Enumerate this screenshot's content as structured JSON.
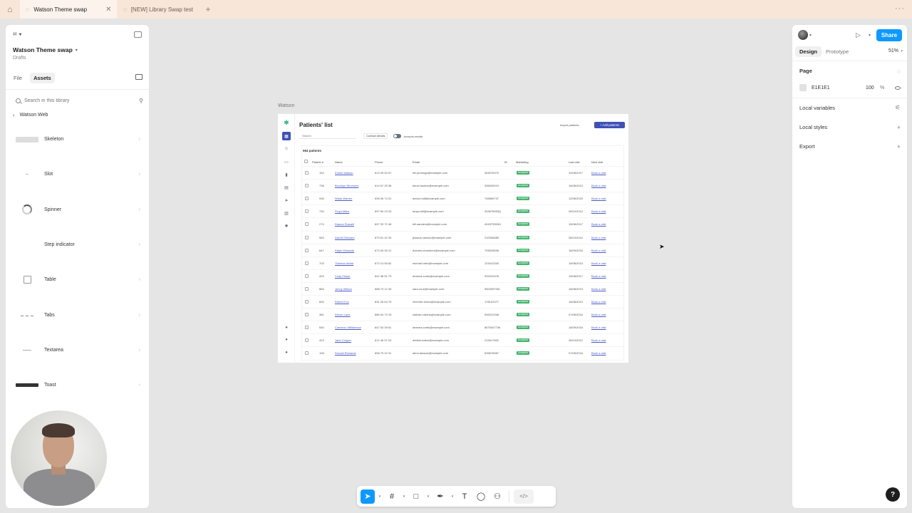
{
  "browser": {
    "tabs": [
      {
        "label": "Watson Theme swap",
        "active": true
      },
      {
        "label": "[NEW] Library Swap test",
        "active": false
      }
    ]
  },
  "left_panel": {
    "file_title": "Watson Theme swap",
    "location": "Drafts",
    "tabs": [
      "File",
      "Assets"
    ],
    "active_tab": "Assets",
    "search_placeholder": "Search in this library",
    "library_name": "Watson Web",
    "components": [
      {
        "name": "Skeleton",
        "thumb": "skeleton"
      },
      {
        "name": "Slot",
        "thumb": "slot"
      },
      {
        "name": "Spinner",
        "thumb": "spinner"
      },
      {
        "name": "Step indicator",
        "thumb": "none"
      },
      {
        "name": "Table",
        "thumb": "table"
      },
      {
        "name": "Tabs",
        "thumb": "tabs"
      },
      {
        "name": "Textarea",
        "thumb": "textarea"
      },
      {
        "name": "Toast",
        "thumb": "toast"
      }
    ]
  },
  "canvas": {
    "frame_label": "Watson",
    "frame": {
      "title": "Patients' list",
      "import_label": "Import patients",
      "add_label": "+ Add patients",
      "search_placeholder": "Search",
      "filter_label": "Contact details",
      "toggle_label": "Accepts emails",
      "count_label": "564 patients",
      "columns": [
        "Patient #",
        "Name",
        "Phone",
        "Email",
        "ID",
        "Marketing",
        "Last visit",
        "Next visit"
      ],
      "rows": [
        {
          "num": "154",
          "name": "Kristin Watson",
          "phone": "613 49 52 87",
          "email": "tim.jennings@example.com",
          "id": "353076370",
          "marketing": "Accepted",
          "last": "10/08/2017",
          "next": "Book a visit"
        },
        {
          "num": "738",
          "name": "Brooklyn Simmons",
          "phone": "614 67 25 38",
          "email": "kenzi.lawson@example.com",
          "id": "335000019",
          "marketing": "Accepted",
          "last": "16/08/2013",
          "next": "Book a visit"
        },
        {
          "num": "936",
          "name": "Wade Warren",
          "phone": "635 96 74 31",
          "email": "debra.holt@example.com",
          "id": "748589747",
          "marketing": "Accepted",
          "last": "12/06/2020",
          "next": "Book a visit"
        },
        {
          "num": "730",
          "name": "Floyd Miles",
          "phone": "697 84 23 33",
          "email": "tanya.hill@example.com",
          "id": "343676593Q",
          "marketing": "Accepted",
          "last": "28/10/2012",
          "next": "Book a visit"
        },
        {
          "num": "274",
          "name": "Dianne Russell",
          "phone": "697 33 72 48",
          "email": "bill.sanders@example.com",
          "id": "404379900H",
          "marketing": "Accepted",
          "last": "15/08/2017",
          "next": "Book a visit"
        },
        {
          "num": "563",
          "name": "Darrell Steward",
          "phone": "679 81 42 26",
          "email": "jessica.hanson@example.com",
          "id": "210006689",
          "marketing": "Accepted",
          "last": "28/10/2012",
          "next": "Book a visit"
        },
        {
          "num": "647",
          "name": "Ralph Edwards",
          "phone": "673 49 39 12",
          "email": "dolores.chambers@example.com",
          "id": "793033536",
          "marketing": "Accepted",
          "last": "18/09/2016",
          "next": "Book a visit"
        },
        {
          "num": "703",
          "name": "Theresa Webb",
          "phone": "673 14 55 82",
          "email": "michael.mitc@example.com",
          "id": "123412340",
          "marketing": "Accepted",
          "last": "16/08/2013",
          "next": "Book a visit"
        },
        {
          "num": "429",
          "name": "Cody Fisher",
          "phone": "642 38 51 79",
          "email": "deanna.curtis@example.com",
          "id": "932910378",
          "marketing": "Accepted",
          "last": "15/08/2017",
          "next": "Book a visit"
        },
        {
          "num": "883",
          "name": "Jenny Wilson",
          "phone": "688 73 12 45",
          "email": "sara.cruz@example.com",
          "id": "950335700L",
          "marketing": "Accepted",
          "last": "16/08/2013",
          "next": "Book a visit"
        },
        {
          "num": "600",
          "name": "Robert Fox",
          "phone": "631 28 64 75",
          "email": "michelle.rivera@example.com",
          "id": "178102377",
          "marketing": "Accepted",
          "last": "16/08/2013",
          "next": "Book a visit"
        },
        {
          "num": "381",
          "name": "Devon Lane",
          "phone": "686 34 72 15",
          "email": "nathan.roberts@example.com",
          "id": "000012346",
          "marketing": "Accepted",
          "last": "07/05/2016",
          "next": "Book a visit"
        },
        {
          "num": "540",
          "name": "Cameron Williamson",
          "phone": "647 53 39 81",
          "email": "deanna.curtis@example.com",
          "id": "807504773K",
          "marketing": "Accepted",
          "last": "18/09/2016",
          "next": "Book a visit"
        },
        {
          "num": "423",
          "name": "Jane Cooper",
          "phone": "612 46 97 03",
          "email": "debbie.baker@example.com",
          "id": "215917502",
          "marketing": "Accepted",
          "last": "28/10/2012",
          "next": "Book a visit"
        },
        {
          "num": "198",
          "name": "Ronald Richards",
          "phone": "698 75 42 31",
          "email": "alma.lawson@example.com",
          "id": "539676587",
          "marketing": "Accepted",
          "last": "07/05/2016",
          "next": "Book a visit"
        }
      ]
    }
  },
  "right_panel": {
    "share_label": "Share",
    "tabs": [
      "Design",
      "Prototype"
    ],
    "active_tab": "Design",
    "zoom": "51%",
    "page_section": "Page",
    "page_color": "E1E1E1",
    "page_opacity": "100",
    "page_opacity_unit": "%",
    "sections": [
      "Local variables",
      "Local styles",
      "Export"
    ],
    "help_label": "?"
  },
  "toolbar": {
    "tools": [
      "move",
      "frame",
      "rectangle",
      "pen",
      "text",
      "comment",
      "actions"
    ],
    "dev_mode_label": "</>"
  },
  "colors": {
    "accent": "#0d99ff",
    "frame_primary": "#3f51b5",
    "badge_green": "#44b36b",
    "tab_strip": "#f8e6d8",
    "canvas_bg": "#e5e5e5"
  }
}
